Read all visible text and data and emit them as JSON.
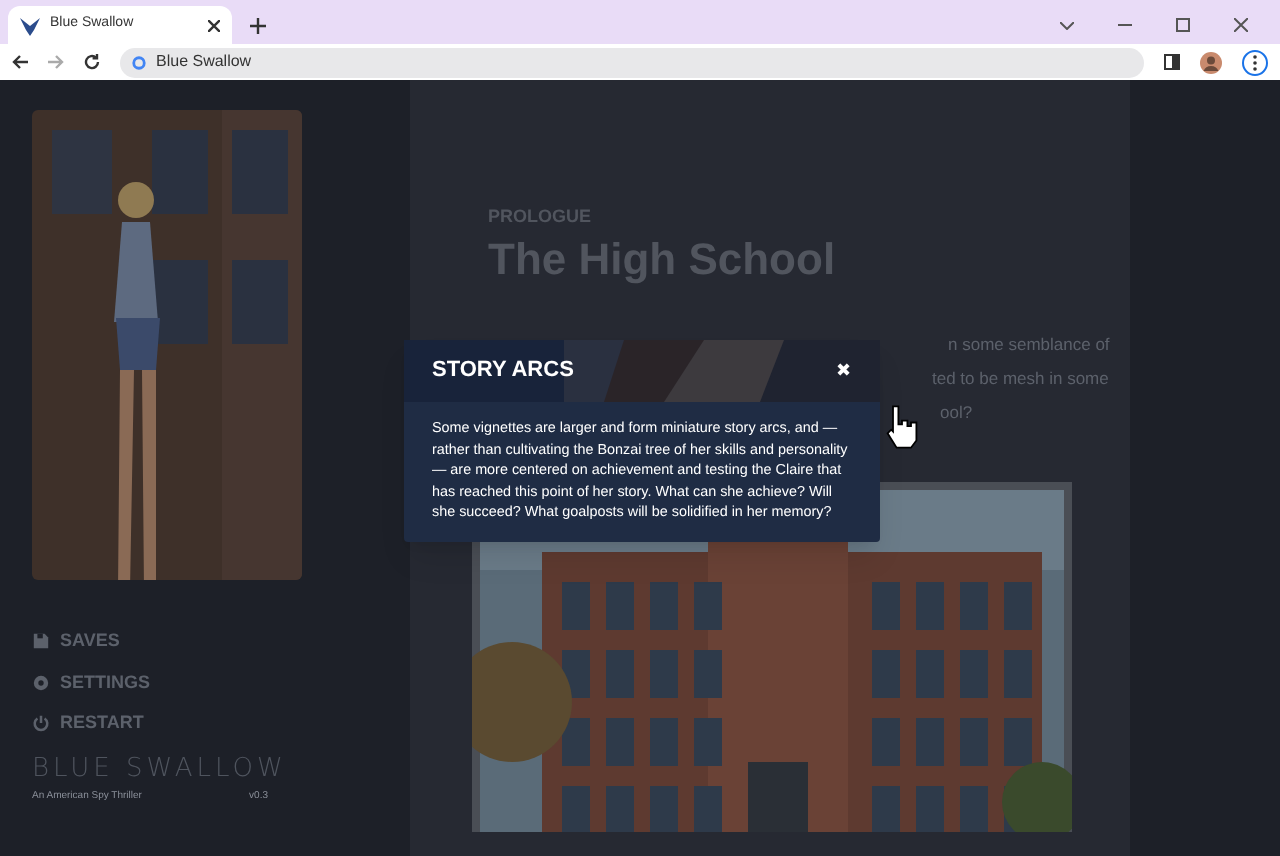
{
  "browser": {
    "tab_title": "Blue Swallow",
    "address": "Blue Swallow"
  },
  "sidebar": {
    "menu": [
      {
        "label": "SAVES",
        "kind": "save"
      },
      {
        "label": "SETTINGS",
        "kind": "gear"
      },
      {
        "label": "RESTART",
        "kind": "power"
      }
    ],
    "logo": "BLUE SWALLOW",
    "tagline": "An American Spy Thriller",
    "version": "v0.3"
  },
  "chapter": {
    "eyebrow": "PROLOGUE",
    "title": "The High School",
    "text_lines": [
      "n some semblance of",
      "ted to be mesh in some",
      "ool?"
    ]
  },
  "modal": {
    "title": "STORY ARCS",
    "close": "✖",
    "body": "Some vignettes are larger and form miniature story arcs, and — rather than cultivating the Bonzai tree of her skills and personality — are more centered on achievement and testing the Claire that has reached this point of her story. What can she achieve? Will she succeed? What goalposts will be solidified in her memory?"
  }
}
